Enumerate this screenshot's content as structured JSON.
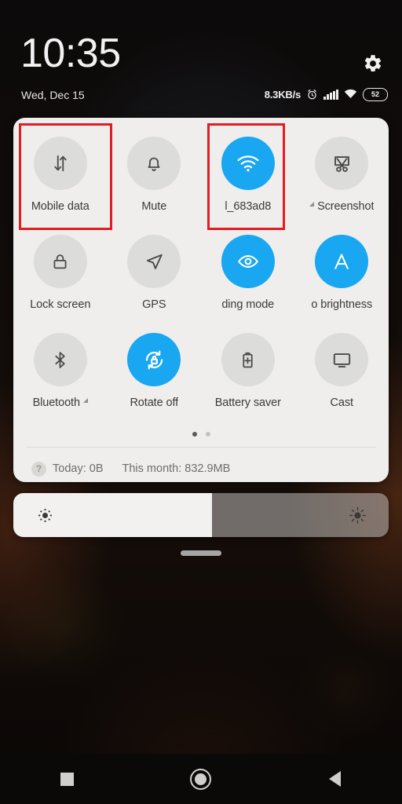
{
  "status_bar": {
    "time": "10:35",
    "date": "Wed, Dec 15",
    "network_speed": "8.3KB/s",
    "battery_percent": "52",
    "gear_icon": "gear-icon",
    "alarm_icon": "alarm-icon",
    "signal_icon": "signal-bars-icon",
    "wifi_icon": "wifi-icon",
    "battery_icon": "battery-icon"
  },
  "quick_settings": {
    "tiles": [
      {
        "label": "Mobile data",
        "icon": "mobile-data-icon",
        "active": false,
        "expandable": false,
        "highlighted": true
      },
      {
        "label": "Mute",
        "icon": "bell-icon",
        "active": false,
        "expandable": false,
        "highlighted": false
      },
      {
        "label": "l_683ad8",
        "icon": "wifi-icon",
        "active": true,
        "expandable": false,
        "highlighted": true
      },
      {
        "label": "Screenshot",
        "icon": "scissors-icon",
        "active": false,
        "expandable": true,
        "highlighted": false
      },
      {
        "label": "Lock screen",
        "icon": "padlock-icon",
        "active": false,
        "expandable": false,
        "highlighted": false
      },
      {
        "label": "GPS",
        "icon": "navigation-arrow-icon",
        "active": false,
        "expandable": false,
        "highlighted": false
      },
      {
        "label": "ding mode",
        "icon": "eye-icon",
        "active": true,
        "expandable": false,
        "highlighted": false
      },
      {
        "label": "o brightness",
        "icon": "auto-brightness-icon",
        "active": true,
        "expandable": false,
        "highlighted": false
      },
      {
        "label": "Bluetooth",
        "icon": "bluetooth-icon",
        "active": false,
        "expandable": true,
        "highlighted": false
      },
      {
        "label": "Rotate off",
        "icon": "rotation-lock-icon",
        "active": true,
        "expandable": false,
        "highlighted": false
      },
      {
        "label": "Battery saver",
        "icon": "battery-plus-icon",
        "active": false,
        "expandable": false,
        "highlighted": false
      },
      {
        "label": "Cast",
        "icon": "monitor-icon",
        "active": false,
        "expandable": false,
        "highlighted": false
      }
    ],
    "pages": {
      "count": 2,
      "current": 1
    },
    "data_usage": {
      "help_icon": "question-mark-icon",
      "today": "Today: 0B",
      "this_month": "This month: 832.9MB"
    }
  },
  "brightness": {
    "level_percent": 53,
    "low_icon": "brightness-low-icon",
    "high_icon": "brightness-high-icon"
  },
  "nav_bar": {
    "recents": "recents-square-icon",
    "home": "home-circle-icon",
    "back": "back-triangle-icon"
  },
  "colors": {
    "accent_blue": "#18a7f0",
    "panel_bg": "#efeeec",
    "highlight_red": "#e31b23",
    "tile_inactive": "#dcdcda"
  }
}
